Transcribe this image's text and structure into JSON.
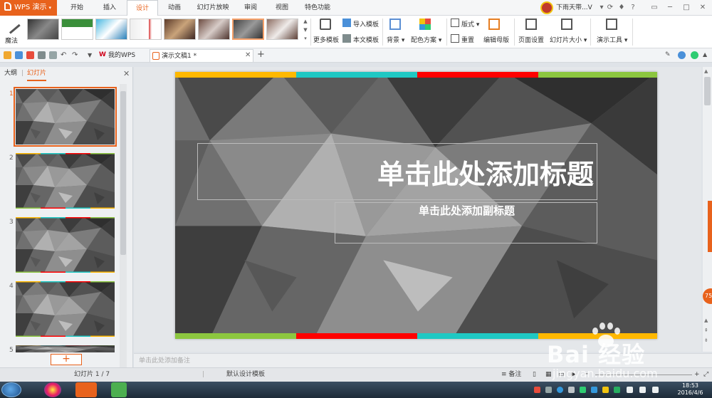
{
  "app": {
    "title": "WPS 演示"
  },
  "menu": {
    "tabs": [
      "开始",
      "插入",
      "设计",
      "动画",
      "幻灯片放映",
      "审阅",
      "视图",
      "特色功能"
    ],
    "active": "设计"
  },
  "user": {
    "name": "下雨天带...V"
  },
  "ribbon": {
    "magic_label": "魔法",
    "more_templates": "更多模板",
    "import_template": "导入模板",
    "this_template": "本文模板",
    "background": "背景",
    "color_scheme": "配色方案",
    "layout": "版式",
    "reset": "重置",
    "edit_master": "编辑母版",
    "page_setup": "页面设置",
    "slide_size": "幻灯片大小",
    "present_tools": "演示工具"
  },
  "quickbar": {
    "tabs": [
      {
        "label": "我的WPS"
      },
      {
        "label": "演示文稿1 *"
      }
    ]
  },
  "left_panel": {
    "tab_outline": "大纲",
    "tab_slides": "幻灯片",
    "slide_numbers": [
      "1",
      "2",
      "3",
      "4",
      "5"
    ],
    "add_label": "+"
  },
  "slide": {
    "title_placeholder": "单击此处添加标题",
    "subtitle_placeholder": "单击此处添加副标题",
    "stripe_colors": [
      "#ffb800",
      "#1fc8c3",
      "#ff0000",
      "#8cc63f"
    ]
  },
  "float_badge": "75",
  "notes": {
    "placeholder": "单击此处添加备注"
  },
  "status": {
    "slide_count": "幻灯片 1 / 7",
    "theme": "默认设计模板",
    "notes_label": "备注"
  },
  "clock": {
    "time": "18:53",
    "date": "2016/4/6"
  },
  "watermark": {
    "text": "Bai  经验",
    "url": "jingyan.baidu.com"
  }
}
